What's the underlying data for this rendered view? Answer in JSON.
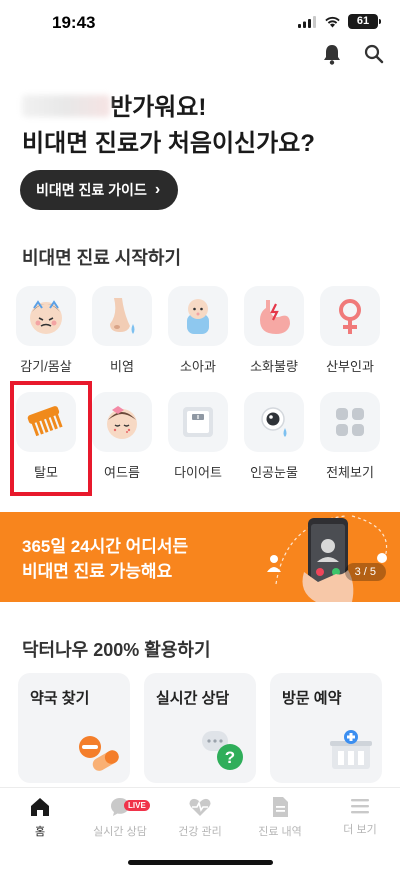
{
  "status_bar": {
    "time": "19:43",
    "battery": "61"
  },
  "greeting": {
    "line1_suffix": "반가워요!",
    "line2": "비대면 진료가 처음이신가요?"
  },
  "guide_button": {
    "label": "비대면 진료 가이드",
    "chevron": "›"
  },
  "start_section": {
    "title": "비대면 진료 시작하기",
    "categories": [
      {
        "label": "감기/몸살",
        "icon": "sick-face-icon"
      },
      {
        "label": "비염",
        "icon": "nose-icon"
      },
      {
        "label": "소아과",
        "icon": "baby-icon"
      },
      {
        "label": "소화불량",
        "icon": "stomach-icon"
      },
      {
        "label": "산부인과",
        "icon": "female-symbol-icon"
      },
      {
        "label": "탈모",
        "icon": "comb-icon"
      },
      {
        "label": "여드름",
        "icon": "acne-face-icon"
      },
      {
        "label": "다이어트",
        "icon": "scale-icon"
      },
      {
        "label": "인공눈물",
        "icon": "eye-drop-icon"
      },
      {
        "label": "전체보기",
        "icon": "grid-icon"
      }
    ]
  },
  "banner": {
    "line1": "365일 24시간 어디서든",
    "line2": "비대면 진료 가능해요",
    "pager": "3 / 5",
    "bg_color": "#f8851d"
  },
  "usage_section": {
    "title": "닥터나우 200% 활용하기",
    "cards": [
      {
        "label": "약국 찾기",
        "icon": "pill-icon"
      },
      {
        "label": "실시간 상담",
        "icon": "chat-question-icon"
      },
      {
        "label": "방문 예약",
        "icon": "hospital-icon"
      }
    ]
  },
  "tabbar": {
    "tabs": [
      {
        "label": "홈",
        "icon": "home-icon"
      },
      {
        "label": "실시간 상담",
        "icon": "chat-icon",
        "badge": "LIVE"
      },
      {
        "label": "건강 관리",
        "icon": "heart-pulse-icon"
      },
      {
        "label": "진료 내역",
        "icon": "document-icon"
      },
      {
        "label": "더 보기",
        "icon": "menu-icon"
      }
    ]
  }
}
